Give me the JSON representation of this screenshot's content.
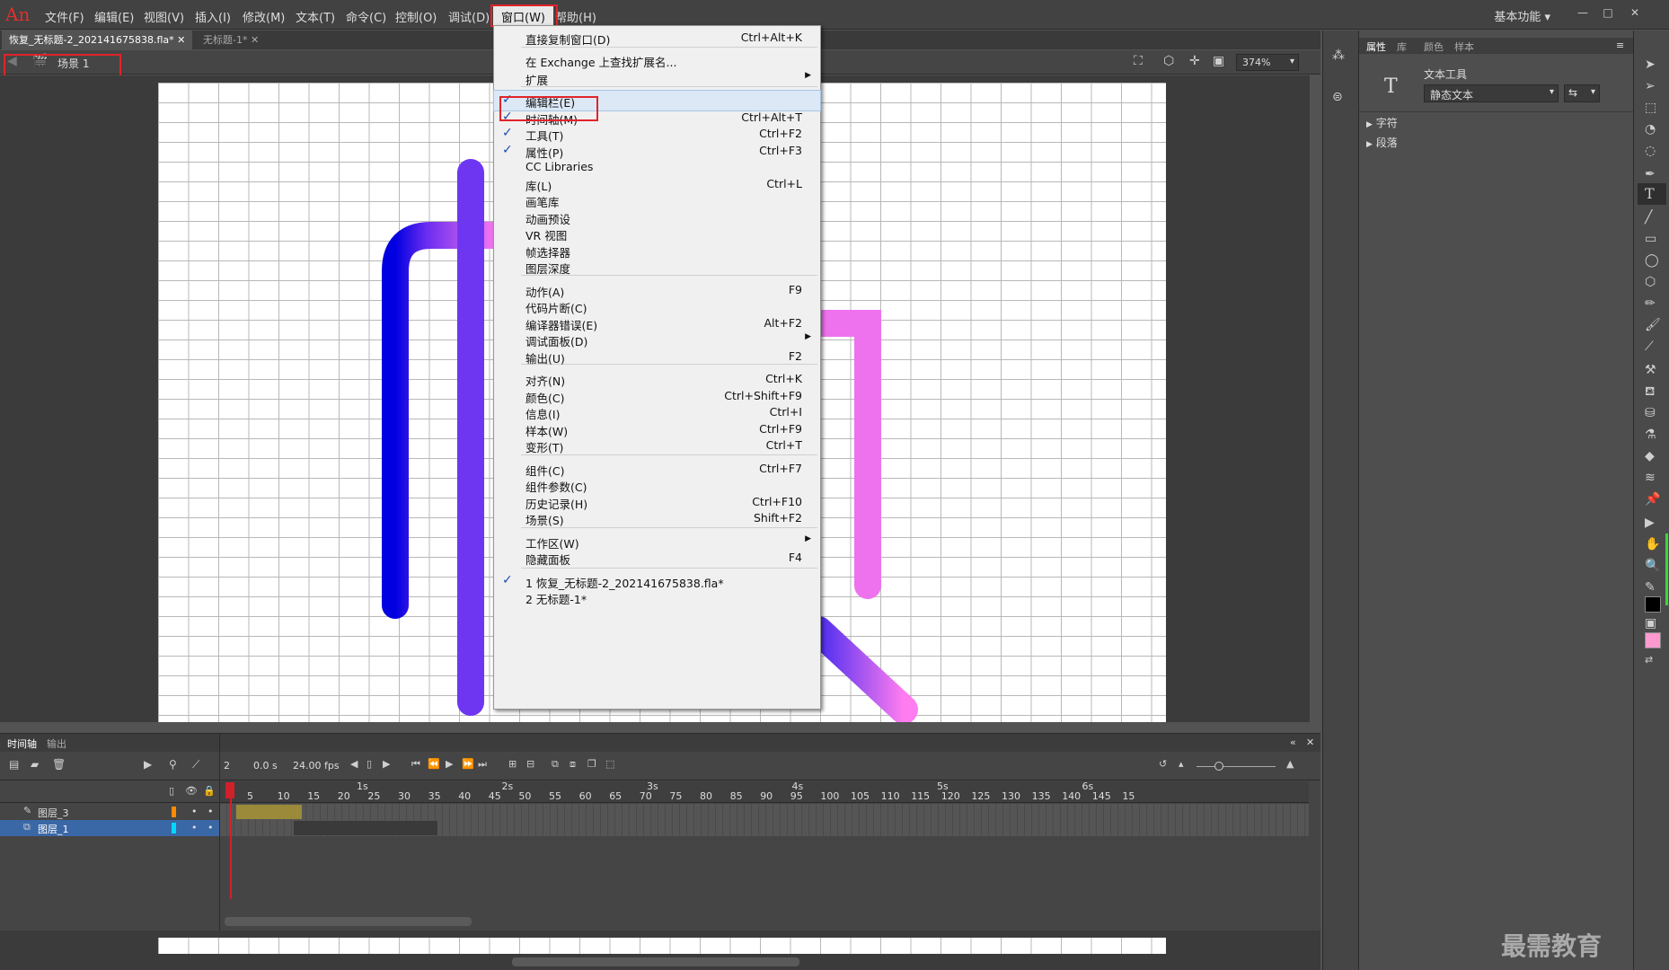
{
  "app": {
    "logo": "An"
  },
  "menubar": {
    "items": [
      "文件(F)",
      "编辑(E)",
      "视图(V)",
      "插入(I)",
      "修改(M)",
      "文本(T)",
      "命令(C)",
      "控制(O)",
      "调试(D)",
      "窗口(W)",
      "帮助(H)"
    ],
    "active": "窗口(W)",
    "workspace": "基本功能"
  },
  "tabs": [
    "恢复_无标题-2_202141675838.fla*",
    "无标题-1*"
  ],
  "scene": {
    "label": "场景 1",
    "zoom": "374%"
  },
  "context_menu": {
    "items": [
      {
        "label": "直接复制窗口(D)",
        "shortcut": "Ctrl+Alt+K",
        "checked": false,
        "submenu": false
      },
      {
        "label": "在 Exchange 上查找扩展名...",
        "shortcut": "",
        "checked": false,
        "submenu": false
      },
      {
        "label": "扩展",
        "shortcut": "",
        "checked": false,
        "submenu": true
      },
      {
        "label": "编辑栏(E)",
        "shortcut": "",
        "checked": true,
        "submenu": false,
        "highlight": true
      },
      {
        "label": "时间轴(M)",
        "shortcut": "Ctrl+Alt+T",
        "checked": true,
        "submenu": false
      },
      {
        "label": "工具(T)",
        "shortcut": "Ctrl+F2",
        "checked": true,
        "submenu": false
      },
      {
        "label": "属性(P)",
        "shortcut": "Ctrl+F3",
        "checked": true,
        "submenu": false
      },
      {
        "label": "CC Libraries",
        "shortcut": "",
        "checked": false,
        "submenu": false
      },
      {
        "label": "库(L)",
        "shortcut": "Ctrl+L",
        "checked": false,
        "submenu": false
      },
      {
        "label": "画笔库",
        "shortcut": "",
        "checked": false,
        "submenu": false
      },
      {
        "label": "动画预设",
        "shortcut": "",
        "checked": false,
        "submenu": false
      },
      {
        "label": "VR 视图",
        "shortcut": "",
        "checked": false,
        "submenu": false
      },
      {
        "label": "帧选择器",
        "shortcut": "",
        "checked": false,
        "submenu": false
      },
      {
        "label": "图层深度",
        "shortcut": "",
        "checked": false,
        "submenu": false
      },
      {
        "label": "动作(A)",
        "shortcut": "F9",
        "checked": false,
        "submenu": false
      },
      {
        "label": "代码片断(C)",
        "shortcut": "",
        "checked": false,
        "submenu": false
      },
      {
        "label": "编译器错误(E)",
        "shortcut": "Alt+F2",
        "checked": false,
        "submenu": false
      },
      {
        "label": "调试面板(D)",
        "shortcut": "",
        "checked": false,
        "submenu": true
      },
      {
        "label": "输出(U)",
        "shortcut": "F2",
        "checked": false,
        "submenu": false
      },
      {
        "label": "对齐(N)",
        "shortcut": "Ctrl+K",
        "checked": false,
        "submenu": false
      },
      {
        "label": "颜色(C)",
        "shortcut": "Ctrl+Shift+F9",
        "checked": false,
        "submenu": false
      },
      {
        "label": "信息(I)",
        "shortcut": "Ctrl+I",
        "checked": false,
        "submenu": false
      },
      {
        "label": "样本(W)",
        "shortcut": "Ctrl+F9",
        "checked": false,
        "submenu": false
      },
      {
        "label": "变形(T)",
        "shortcut": "Ctrl+T",
        "checked": false,
        "submenu": false
      },
      {
        "label": "组件(C)",
        "shortcut": "Ctrl+F7",
        "checked": false,
        "submenu": false
      },
      {
        "label": "组件参数(C)",
        "shortcut": "",
        "checked": false,
        "submenu": false
      },
      {
        "label": "历史记录(H)",
        "shortcut": "Ctrl+F10",
        "checked": false,
        "submenu": false
      },
      {
        "label": "场景(S)",
        "shortcut": "Shift+F2",
        "checked": false,
        "submenu": false
      },
      {
        "label": "工作区(W)",
        "shortcut": "",
        "checked": false,
        "submenu": true
      },
      {
        "label": "隐藏面板",
        "shortcut": "F4",
        "checked": false,
        "submenu": false
      },
      {
        "label": "1 恢复_无标题-2_202141675838.fla*",
        "shortcut": "",
        "checked": true,
        "submenu": false
      },
      {
        "label": "2 无标题-1*",
        "shortcut": "",
        "checked": false,
        "submenu": false
      }
    ]
  },
  "timeline": {
    "tabs": [
      "时间轴",
      "输出"
    ],
    "frame": "2",
    "time": "0.0 s",
    "fps": "24.00 fps",
    "ruler_numbers": [
      "5",
      "10",
      "15",
      "20",
      "25",
      "30",
      "35",
      "40",
      "45",
      "50",
      "55",
      "60",
      "65",
      "70",
      "75",
      "80",
      "85",
      "90",
      "95",
      "100",
      "105",
      "110",
      "115",
      "120",
      "125",
      "130",
      "135",
      "140",
      "145",
      "15"
    ],
    "seconds": [
      "1s",
      "2s",
      "3s",
      "4s",
      "5s",
      "6s"
    ],
    "layers": [
      {
        "name": "图层_3",
        "color": "#ff8a00",
        "selected": false
      },
      {
        "name": "图层_1",
        "color": "#00d8ff",
        "selected": true
      }
    ]
  },
  "properties": {
    "tabs": [
      "属性",
      "库",
      "颜色",
      "样本"
    ],
    "tool_name": "文本工具",
    "text_type": "静态文本",
    "sections": [
      "字符",
      "段落"
    ]
  },
  "watermark": "最需教育",
  "colors": {
    "accent_red": "#e2232a",
    "fill": "#ff9ad0"
  }
}
